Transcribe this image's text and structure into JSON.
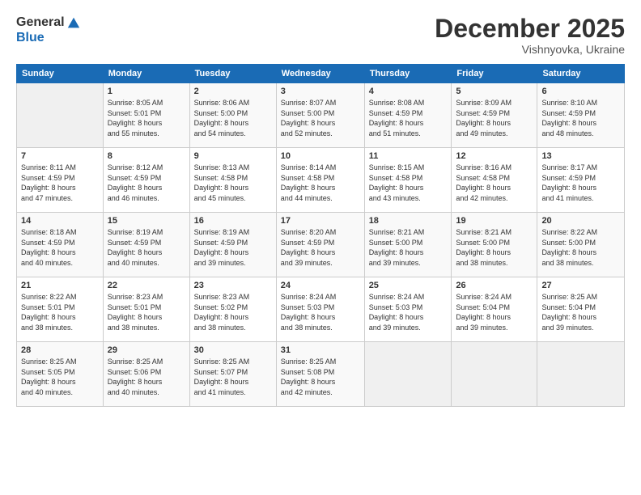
{
  "logo": {
    "general": "General",
    "blue": "Blue"
  },
  "header": {
    "month": "December 2025",
    "location": "Vishnyovka, Ukraine"
  },
  "calendar": {
    "days_of_week": [
      "Sunday",
      "Monday",
      "Tuesday",
      "Wednesday",
      "Thursday",
      "Friday",
      "Saturday"
    ],
    "weeks": [
      [
        {
          "day": "",
          "info": ""
        },
        {
          "day": "1",
          "info": "Sunrise: 8:05 AM\nSunset: 5:01 PM\nDaylight: 8 hours\nand 55 minutes."
        },
        {
          "day": "2",
          "info": "Sunrise: 8:06 AM\nSunset: 5:00 PM\nDaylight: 8 hours\nand 54 minutes."
        },
        {
          "day": "3",
          "info": "Sunrise: 8:07 AM\nSunset: 5:00 PM\nDaylight: 8 hours\nand 52 minutes."
        },
        {
          "day": "4",
          "info": "Sunrise: 8:08 AM\nSunset: 4:59 PM\nDaylight: 8 hours\nand 51 minutes."
        },
        {
          "day": "5",
          "info": "Sunrise: 8:09 AM\nSunset: 4:59 PM\nDaylight: 8 hours\nand 49 minutes."
        },
        {
          "day": "6",
          "info": "Sunrise: 8:10 AM\nSunset: 4:59 PM\nDaylight: 8 hours\nand 48 minutes."
        }
      ],
      [
        {
          "day": "7",
          "info": "Sunrise: 8:11 AM\nSunset: 4:59 PM\nDaylight: 8 hours\nand 47 minutes."
        },
        {
          "day": "8",
          "info": "Sunrise: 8:12 AM\nSunset: 4:59 PM\nDaylight: 8 hours\nand 46 minutes."
        },
        {
          "day": "9",
          "info": "Sunrise: 8:13 AM\nSunset: 4:58 PM\nDaylight: 8 hours\nand 45 minutes."
        },
        {
          "day": "10",
          "info": "Sunrise: 8:14 AM\nSunset: 4:58 PM\nDaylight: 8 hours\nand 44 minutes."
        },
        {
          "day": "11",
          "info": "Sunrise: 8:15 AM\nSunset: 4:58 PM\nDaylight: 8 hours\nand 43 minutes."
        },
        {
          "day": "12",
          "info": "Sunrise: 8:16 AM\nSunset: 4:58 PM\nDaylight: 8 hours\nand 42 minutes."
        },
        {
          "day": "13",
          "info": "Sunrise: 8:17 AM\nSunset: 4:59 PM\nDaylight: 8 hours\nand 41 minutes."
        }
      ],
      [
        {
          "day": "14",
          "info": "Sunrise: 8:18 AM\nSunset: 4:59 PM\nDaylight: 8 hours\nand 40 minutes."
        },
        {
          "day": "15",
          "info": "Sunrise: 8:19 AM\nSunset: 4:59 PM\nDaylight: 8 hours\nand 40 minutes."
        },
        {
          "day": "16",
          "info": "Sunrise: 8:19 AM\nSunset: 4:59 PM\nDaylight: 8 hours\nand 39 minutes."
        },
        {
          "day": "17",
          "info": "Sunrise: 8:20 AM\nSunset: 4:59 PM\nDaylight: 8 hours\nand 39 minutes."
        },
        {
          "day": "18",
          "info": "Sunrise: 8:21 AM\nSunset: 5:00 PM\nDaylight: 8 hours\nand 39 minutes."
        },
        {
          "day": "19",
          "info": "Sunrise: 8:21 AM\nSunset: 5:00 PM\nDaylight: 8 hours\nand 38 minutes."
        },
        {
          "day": "20",
          "info": "Sunrise: 8:22 AM\nSunset: 5:00 PM\nDaylight: 8 hours\nand 38 minutes."
        }
      ],
      [
        {
          "day": "21",
          "info": "Sunrise: 8:22 AM\nSunset: 5:01 PM\nDaylight: 8 hours\nand 38 minutes."
        },
        {
          "day": "22",
          "info": "Sunrise: 8:23 AM\nSunset: 5:01 PM\nDaylight: 8 hours\nand 38 minutes."
        },
        {
          "day": "23",
          "info": "Sunrise: 8:23 AM\nSunset: 5:02 PM\nDaylight: 8 hours\nand 38 minutes."
        },
        {
          "day": "24",
          "info": "Sunrise: 8:24 AM\nSunset: 5:03 PM\nDaylight: 8 hours\nand 38 minutes."
        },
        {
          "day": "25",
          "info": "Sunrise: 8:24 AM\nSunset: 5:03 PM\nDaylight: 8 hours\nand 39 minutes."
        },
        {
          "day": "26",
          "info": "Sunrise: 8:24 AM\nSunset: 5:04 PM\nDaylight: 8 hours\nand 39 minutes."
        },
        {
          "day": "27",
          "info": "Sunrise: 8:25 AM\nSunset: 5:04 PM\nDaylight: 8 hours\nand 39 minutes."
        }
      ],
      [
        {
          "day": "28",
          "info": "Sunrise: 8:25 AM\nSunset: 5:05 PM\nDaylight: 8 hours\nand 40 minutes."
        },
        {
          "day": "29",
          "info": "Sunrise: 8:25 AM\nSunset: 5:06 PM\nDaylight: 8 hours\nand 40 minutes."
        },
        {
          "day": "30",
          "info": "Sunrise: 8:25 AM\nSunset: 5:07 PM\nDaylight: 8 hours\nand 41 minutes."
        },
        {
          "day": "31",
          "info": "Sunrise: 8:25 AM\nSunset: 5:08 PM\nDaylight: 8 hours\nand 42 minutes."
        },
        {
          "day": "",
          "info": ""
        },
        {
          "day": "",
          "info": ""
        },
        {
          "day": "",
          "info": ""
        }
      ]
    ]
  }
}
